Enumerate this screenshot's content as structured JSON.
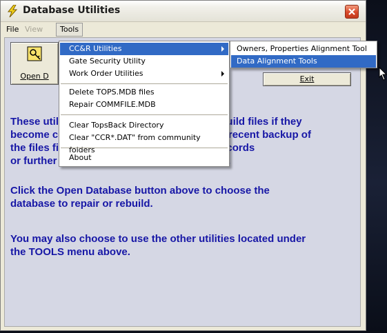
{
  "window": {
    "title": "Database Utilities"
  },
  "menubar": {
    "file": "File",
    "view": "View",
    "tools": "Tools"
  },
  "buttons": {
    "open_label": "Open Database",
    "open_visible": "Open D",
    "exit_label": "Exit"
  },
  "info": {
    "para1_lines": [
      "These utilities can be used to repair and rebuild files if they",
      "become corrupted. Be sure that you make a recent backup of",
      "the files first. There is a possibility of lost records",
      "or further damage when using these utilities."
    ],
    "para2_lines": [
      "Click the Open Database button above to choose the",
      "database to repair or rebuild."
    ],
    "para3_lines": [
      "You may also choose to use the other utilities located under",
      "the TOOLS menu above."
    ]
  },
  "tools_menu": {
    "items": [
      "CC&R Utilities",
      "Gate Security Utility",
      "Work Order Utilities",
      "Delete TOPS.MDB files",
      "Repair COMMFILE.MDB",
      "Clear TopsBack Directory",
      "Clear \"CCR*.DAT\" from community folders",
      "About"
    ]
  },
  "ccr_submenu": {
    "items": [
      "Owners, Properties Alignment Tool",
      "Data Alignment Tools"
    ]
  },
  "colors": {
    "info_text": "#1717a6",
    "highlight": "#316ac5"
  },
  "icons": [
    "lightning-icon",
    "close-icon",
    "database-key-icon",
    "submenu-arrow-icon",
    "mouse-cursor-icon"
  ]
}
